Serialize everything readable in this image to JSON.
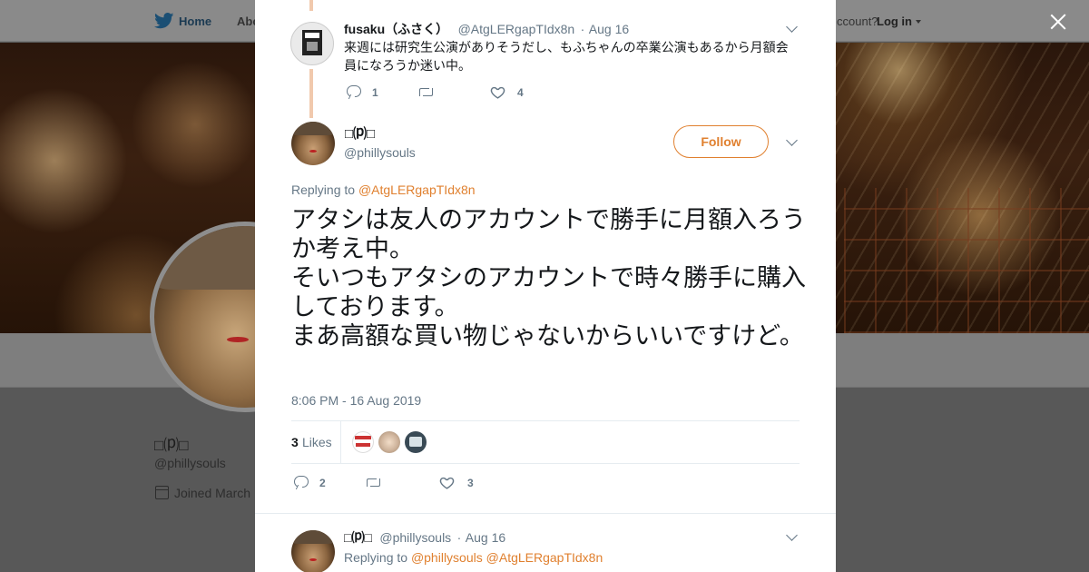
{
  "background": {
    "nav": {
      "home": "Home",
      "about": "Abo",
      "account": "ccount?",
      "login": "Log in"
    },
    "profile": {
      "name": "□⒫□",
      "handle": "@phillysouls",
      "joined": "Joined March"
    }
  },
  "modal": {
    "parent_tweet": {
      "name": "fusaku（ふさく）",
      "handle": "@AtgLERgapTIdx8n",
      "separator": "·",
      "date": "Aug 16",
      "text": "来週には研究生公演がありそうだし、もふちゃんの卒業公演もあるから月額会員になろうか迷い中。",
      "replies": "1",
      "retweets": "",
      "likes": "4"
    },
    "main_tweet": {
      "name": "□⒫□",
      "handle": "@phillysouls",
      "follow_label": "Follow",
      "replying_prefix": "Replying to",
      "replying_to": "@AtgLERgapTIdx8n",
      "text": "アタシは友人のアカウントで勝手に月額入ろうか考え中。\nそいつもアタシのアカウントで時々勝手に購入しております。\nまあ高額な買い物じゃないからいいですけど。",
      "timestamp": "8:06 PM - 16 Aug 2019",
      "likes_count": "3",
      "likes_label": "Likes",
      "replies": "2",
      "retweets": "",
      "likes": "3"
    },
    "reply_tweet": {
      "name": "□⒫□",
      "handle": "@phillysouls",
      "separator": "·",
      "date": "Aug 16",
      "replying_prefix": "Replying to",
      "replying_to_1": "@phillysouls",
      "replying_to_2": "@AtgLERgapTIdx8n"
    }
  },
  "icons": [
    "twitter-bird-icon",
    "close-icon",
    "reply-icon",
    "retweet-icon",
    "heart-icon",
    "chevron-down-icon",
    "calendar-icon"
  ],
  "colors": {
    "accent": "#e0802f",
    "muted": "#657786",
    "thread_line": "#f1c9ad",
    "overlay": "#585858"
  }
}
